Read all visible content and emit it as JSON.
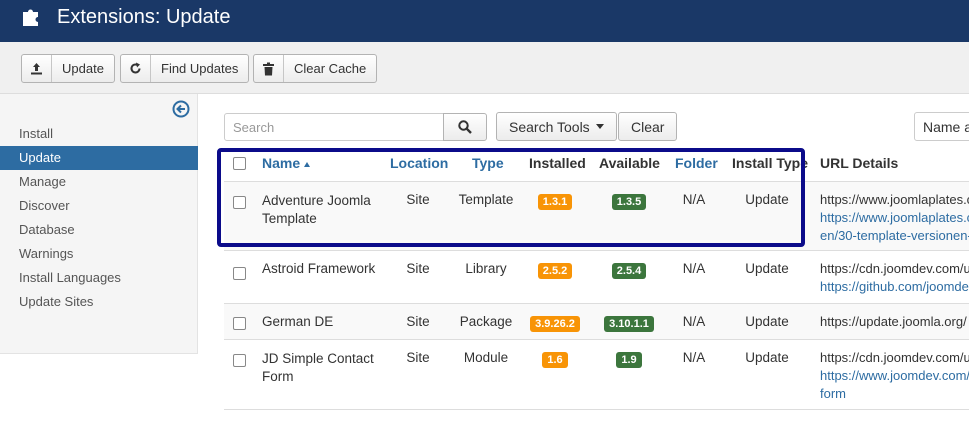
{
  "header": {
    "title": "Extensions: Update"
  },
  "toolbar": {
    "update_label": "Update",
    "find_updates_label": "Find Updates",
    "clear_cache_label": "Clear Cache"
  },
  "sidebar": {
    "items": [
      {
        "label": "Install",
        "active": false
      },
      {
        "label": "Update",
        "active": true
      },
      {
        "label": "Manage",
        "active": false
      },
      {
        "label": "Discover",
        "active": false
      },
      {
        "label": "Database",
        "active": false
      },
      {
        "label": "Warnings",
        "active": false
      },
      {
        "label": "Install Languages",
        "active": false
      },
      {
        "label": "Update Sites",
        "active": false
      }
    ]
  },
  "filters": {
    "search_placeholder": "Search",
    "search_tools_label": "Search Tools",
    "clear_label": "Clear",
    "sort_label": "Name a"
  },
  "table": {
    "columns": {
      "name": "Name",
      "location": "Location",
      "type": "Type",
      "installed": "Installed",
      "available": "Available",
      "folder": "Folder",
      "install_type": "Install Type",
      "url_details": "URL Details"
    },
    "rows": [
      {
        "name_line1": "Adventure Joomla",
        "name_line2": "Template",
        "location": "Site",
        "type": "Template",
        "installed": "1.3.1",
        "available": "1.3.5",
        "folder": "N/A",
        "install_type": "Update",
        "url1": "https://www.joomlaplates.c",
        "url2": "https://www.joomlaplates.c",
        "url3": "en/30-template-versionen-"
      },
      {
        "name_line1": "Astroid Framework",
        "name_line2": "",
        "location": "Site",
        "type": "Library",
        "installed": "2.5.2",
        "available": "2.5.4",
        "folder": "N/A",
        "install_type": "Update",
        "url1": "https://cdn.joomdev.com/u",
        "url2": "https://github.com/joomde",
        "url3": ""
      },
      {
        "name_line1": "German DE",
        "name_line2": "",
        "location": "Site",
        "type": "Package",
        "installed": "3.9.26.2",
        "available": "3.10.1.1",
        "folder": "N/A",
        "install_type": "Update",
        "url1": "https://update.joomla.org/",
        "url2": "",
        "url3": ""
      },
      {
        "name_line1": "JD Simple Contact",
        "name_line2": "Form",
        "location": "Site",
        "type": "Module",
        "installed": "1.6",
        "available": "1.9",
        "folder": "N/A",
        "install_type": "Update",
        "url1": "https://cdn.joomdev.com/u",
        "url2": "https://www.joomdev.com/",
        "url3": "form"
      }
    ]
  },
  "colors": {
    "header_bg": "#1a3867",
    "active_nav": "#2d6ca2",
    "link_blue": "#2d6ca2",
    "badge_installed": "#f89406",
    "badge_available": "#3c763d",
    "highlight_border": "#0b0b8a"
  },
  "icons": {
    "header": "puzzle-icon",
    "update": "upload-icon",
    "find_updates": "refresh-icon",
    "clear_cache": "trash-icon",
    "sidebar_toggle": "arrow-left-circle-icon",
    "search": "search-icon"
  }
}
